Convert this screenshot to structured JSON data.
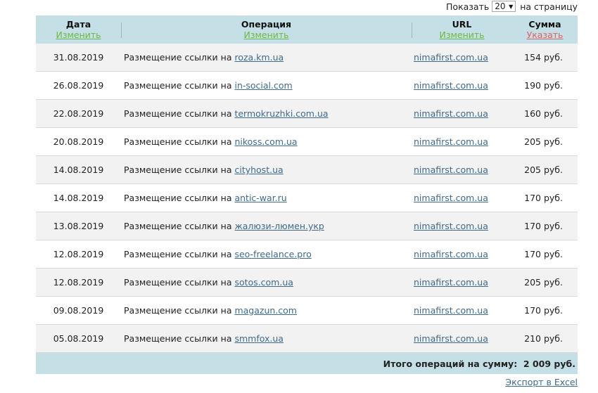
{
  "per_page": {
    "prefix": "Показать",
    "value": "20",
    "suffix": "на страницу"
  },
  "columns": [
    {
      "title": "Дата",
      "sort_label": "Изменить",
      "active": false
    },
    {
      "title": "Операция",
      "sort_label": "Изменить",
      "active": false
    },
    {
      "title": "URL",
      "sort_label": "Изменить",
      "active": false
    },
    {
      "title": "Сумма",
      "sort_label": "Указать",
      "active": true
    }
  ],
  "rows": [
    {
      "date": "31.08.2019",
      "op_text": "Размещение ссылки на",
      "op_link": "roza.km.ua",
      "url": "nimafirst.com.ua",
      "sum": "154 руб."
    },
    {
      "date": "26.08.2019",
      "op_text": "Размещение ссылки на",
      "op_link": "in-social.com",
      "url": "nimafirst.com.ua",
      "sum": "190 руб."
    },
    {
      "date": "22.08.2019",
      "op_text": "Размещение ссылки на",
      "op_link": "termokruzhki.com.ua",
      "url": "nimafirst.com.ua",
      "sum": "160 руб."
    },
    {
      "date": "20.08.2019",
      "op_text": "Размещение ссылки на",
      "op_link": "nikoss.com.ua",
      "url": "nimafirst.com.ua",
      "sum": "205 руб."
    },
    {
      "date": "14.08.2019",
      "op_text": "Размещение ссылки на",
      "op_link": "cityhost.ua",
      "url": "nimafirst.com.ua",
      "sum": "205 руб."
    },
    {
      "date": "14.08.2019",
      "op_text": "Размещение ссылки на",
      "op_link": "antic-war.ru",
      "url": "nimafirst.com.ua",
      "sum": "170 руб."
    },
    {
      "date": "13.08.2019",
      "op_text": "Размещение ссылки на",
      "op_link": "жалюзи-люмен.укр",
      "url": "nimafirst.com.ua",
      "sum": "170 руб."
    },
    {
      "date": "12.08.2019",
      "op_text": "Размещение ссылки на",
      "op_link": "seo-freelance.pro",
      "url": "nimafirst.com.ua",
      "sum": "170 руб."
    },
    {
      "date": "12.08.2019",
      "op_text": "Размещение ссылки на",
      "op_link": "sotos.com.ua",
      "url": "nimafirst.com.ua",
      "sum": "205 руб."
    },
    {
      "date": "09.08.2019",
      "op_text": "Размещение ссылки на",
      "op_link": "magazun.com",
      "url": "nimafirst.com.ua",
      "sum": "170 руб."
    },
    {
      "date": "05.08.2019",
      "op_text": "Размещение ссылки на",
      "op_link": "smmfox.ua",
      "url": "nimafirst.com.ua",
      "sum": "210 руб."
    }
  ],
  "total": {
    "label": "Итого операций на сумму:",
    "value": "2 009 руб."
  },
  "export_label": "Экспорт в Excel",
  "colors": {
    "header_bg": "#c5dfe6",
    "sort_link": "#6cb93f",
    "sort_link_active": "#e06060",
    "link": "#3e6a8c",
    "row_alt": "#f2f2f2"
  }
}
